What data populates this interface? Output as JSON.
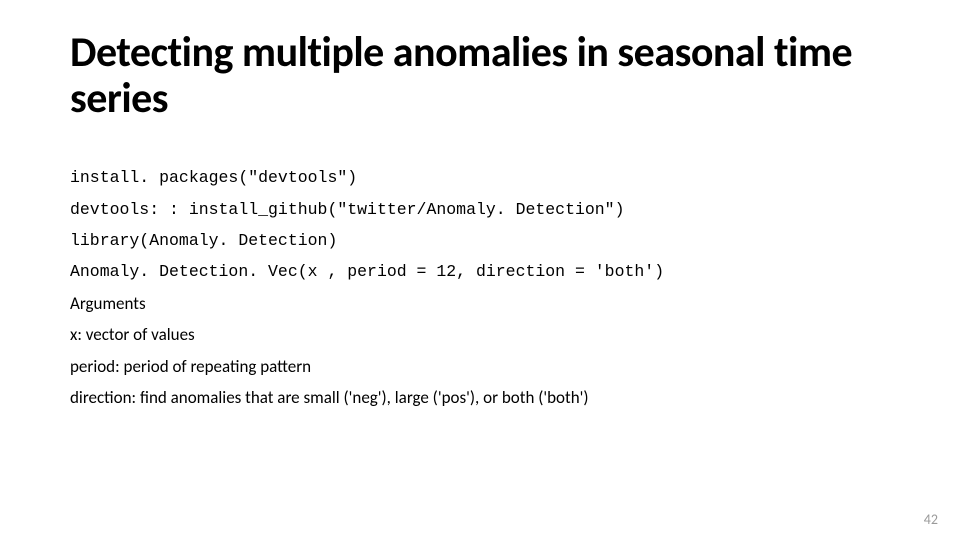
{
  "slide": {
    "title": "Detecting multiple anomalies in seasonal time series",
    "code_lines": [
      "install. packages(\"devtools\")",
      "devtools: : install_github(\"twitter/Anomaly. Detection\")",
      "library(Anomaly. Detection)",
      "Anomaly. Detection. Vec(x , period = 12, direction = 'both')"
    ],
    "body_lines": [
      "Arguments",
      "x: vector of values",
      "period: period of repeating pattern",
      "direction: find anomalies that are small ('neg'), large ('pos'), or both ('both')"
    ],
    "page_number": "42"
  }
}
